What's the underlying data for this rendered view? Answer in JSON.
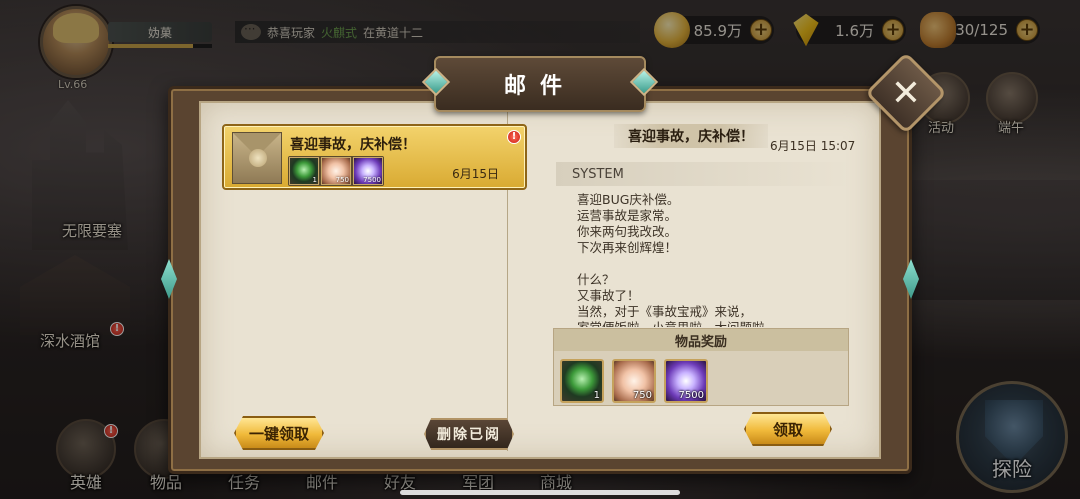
{
  "player": {
    "name": "妫菓",
    "level": "Lv.66",
    "exp_fraction": 0.82
  },
  "broadcast": {
    "prefix": "恭喜玩家",
    "highlight": "火麒式",
    "suffix": "在黄道十二"
  },
  "resources": {
    "gold": "85.9万",
    "gems": "1.6万",
    "stamina": "30/125"
  },
  "events": {
    "activity": "活动",
    "dragon_boat": "端午"
  },
  "map": {
    "fortress": "无限要塞",
    "tavern": "深水酒馆"
  },
  "bottom_nav": {
    "heroes": "英雄",
    "items": "物品",
    "tasks": "任务",
    "mail": "邮件",
    "friends": "好友",
    "guild": "军团",
    "shop": "商城",
    "explore": "探险"
  },
  "mail_window": {
    "title": "邮件",
    "close_symbol": "✕",
    "list": [
      {
        "title": "喜迎事故，庆补偿！",
        "date": "6月15日",
        "alert": "!",
        "items": [
          {
            "icon": "green-orb-icon",
            "count": "1"
          },
          {
            "icon": "pouch-icon",
            "count": "750"
          },
          {
            "icon": "purple-crystal-icon",
            "count": "7500"
          }
        ]
      }
    ],
    "claim_all_label": "一键领取",
    "delete_read_label": "删除已阅",
    "detail": {
      "title": "喜迎事故，庆补偿！",
      "datetime": "6月15日 15:07",
      "sender": "SYSTEM",
      "body": "喜迎BUG庆补偿。\n运营事故是家常。\n你来两句我改改。\n下次再来创辉煌！\n\n什么？\n又事故了！\n当然，对于《事故宝戒》来说，\n家常便饭啦，小意思啦，大问题啦。",
      "rewards_header": "物品奖励",
      "rewards": [
        {
          "icon": "green-orb-icon",
          "count": "1"
        },
        {
          "icon": "pouch-icon",
          "count": "750"
        },
        {
          "icon": "purple-crystal-icon",
          "count": "7500"
        }
      ],
      "claim_label": "领取"
    }
  }
}
